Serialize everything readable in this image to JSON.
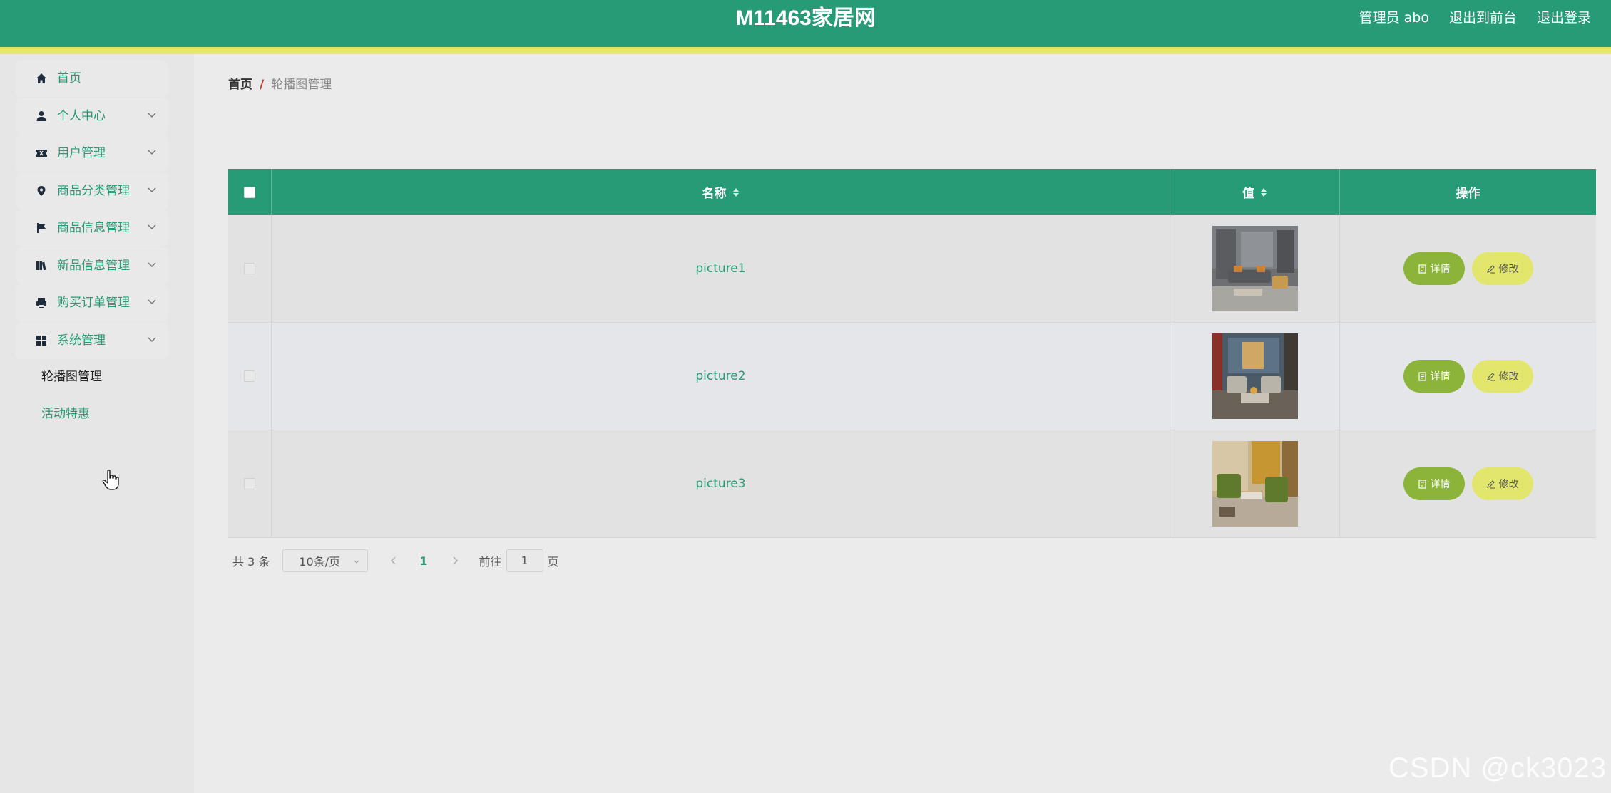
{
  "header": {
    "title": "M11463家居网",
    "admin_label": "管理员 abo",
    "to_front_label": "退出到前台",
    "logout_label": "退出登录"
  },
  "colors": {
    "primary": "#279a76",
    "accent_strip": "#e3e86b",
    "detail_button": "#8cb43a",
    "edit_button": "#e2e66c"
  },
  "sidebar": {
    "items": [
      {
        "label": "首页",
        "icon": "home-icon"
      },
      {
        "label": "个人中心",
        "icon": "user-icon"
      },
      {
        "label": "用户管理",
        "icon": "ticket-icon"
      },
      {
        "label": "商品分类管理",
        "icon": "location-icon"
      },
      {
        "label": "商品信息管理",
        "icon": "flag-icon"
      },
      {
        "label": "新品信息管理",
        "icon": "books-icon"
      },
      {
        "label": "购买订单管理",
        "icon": "printer-icon"
      },
      {
        "label": "系统管理",
        "icon": "grid-icon"
      }
    ],
    "submenu": [
      {
        "label": "轮播图管理"
      },
      {
        "label": "活动特惠"
      }
    ]
  },
  "breadcrumb": {
    "home": "首页",
    "separator": "/",
    "current": "轮播图管理"
  },
  "table": {
    "headers": {
      "name": "名称",
      "value": "值",
      "ops": "操作"
    },
    "rows": [
      {
        "name": "picture1",
        "detail": "详情",
        "edit": "修改"
      },
      {
        "name": "picture2",
        "detail": "详情",
        "edit": "修改"
      },
      {
        "name": "picture3",
        "detail": "详情",
        "edit": "修改"
      }
    ]
  },
  "pagination": {
    "total": "共 3 条",
    "page_size": "10条/页",
    "current_page": "1",
    "goto_label": "前往",
    "goto_value": "1",
    "page_suffix": "页"
  },
  "watermark": "CSDN @ck3023"
}
